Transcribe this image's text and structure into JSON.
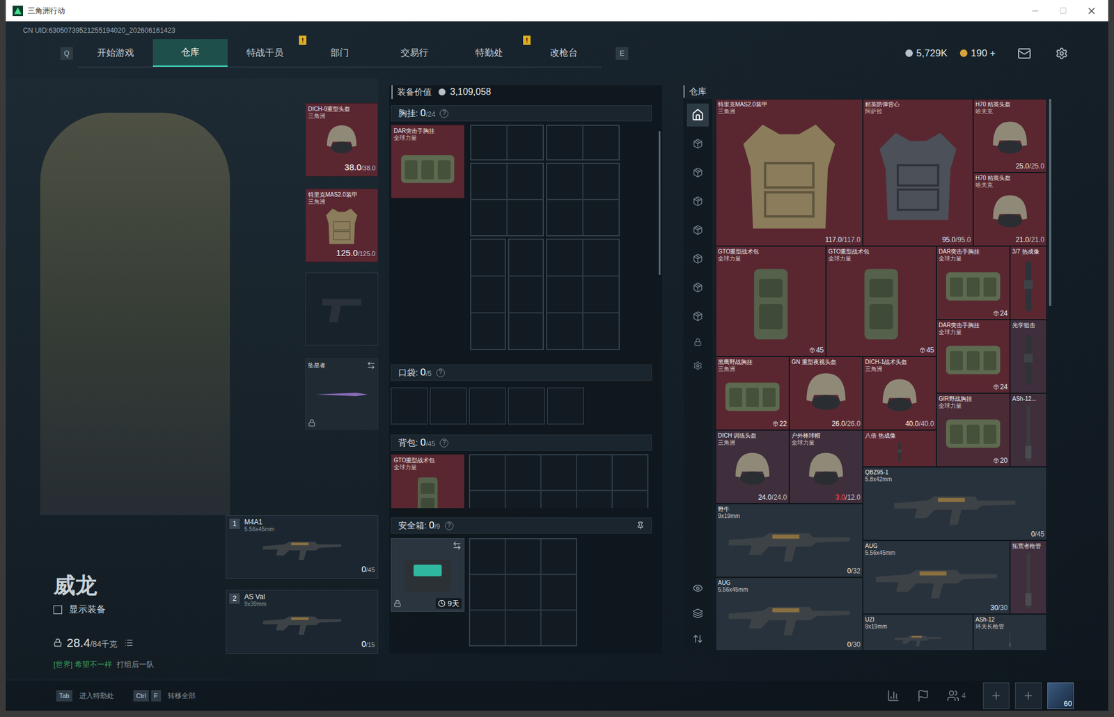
{
  "window": {
    "title": "三角洲行动"
  },
  "uid": "CN UID:63050739521255194020_202606161423",
  "nav": {
    "key_left": "Q",
    "key_right": "E",
    "tabs": [
      {
        "label": "开始游戏",
        "selected": false,
        "badge": ""
      },
      {
        "label": "仓库",
        "selected": true,
        "badge": ""
      },
      {
        "label": "特战干员",
        "selected": false,
        "badge": "!"
      },
      {
        "label": "部门",
        "selected": false,
        "badge": ""
      },
      {
        "label": "交易行",
        "selected": false,
        "badge": ""
      },
      {
        "label": "特勤处",
        "selected": false,
        "badge": "!"
      },
      {
        "label": "改枪台",
        "selected": false,
        "badge": ""
      }
    ],
    "currency": [
      {
        "value": "5,729K",
        "color": "#b8c0c8"
      },
      {
        "value": "190 +",
        "color": "#d8a43a"
      }
    ]
  },
  "character": {
    "name": "威龙",
    "show_equipment": {
      "label": "显示装备",
      "checked": false
    },
    "weight": "28.4",
    "weight_max": "/84千克",
    "chat": {
      "channel": "[世界]",
      "sender": "希望不一样",
      "message": "打组后一队"
    }
  },
  "slots": {
    "helmet": {
      "name": "DICH-9重型头盔",
      "sub": "三角洲",
      "count": "38.0",
      "max": "/38.0"
    },
    "armor": {
      "name": "特里克MAS2.0装甲",
      "sub": "三角洲",
      "count": "125.0",
      "max": "/125.0"
    },
    "pistol": {
      "empty": true
    },
    "melee": {
      "name": "坠星者",
      "locked": true
    }
  },
  "weapons": [
    {
      "index": "1",
      "name": "M4A1",
      "caliber": "5.56x45mm",
      "ammo": "0",
      "max": "/45"
    },
    {
      "index": "2",
      "name": "AS Val",
      "caliber": "9x39mm",
      "ammo": "0",
      "max": "/15"
    }
  ],
  "loadout": {
    "value_label": "装备价值",
    "value": "3,109,058",
    "chest": {
      "label": "胸挂:",
      "count": "0",
      "capacity": "/24",
      "help": "?",
      "item": {
        "name": "DAR突击手胸挂",
        "sub": "全球力量",
        "kind": "rig"
      }
    },
    "pocket": {
      "label": "口袋:",
      "count": "0",
      "capacity": "/5",
      "help": "?"
    },
    "backpack": {
      "label": "背包:",
      "count": "0",
      "capacity": "/45",
      "help": "?",
      "item": {
        "name": "GTO重型战术包",
        "sub": "全球力量",
        "kind": "bag"
      }
    },
    "secure": {
      "label": "安全箱:",
      "count": "0",
      "capacity": "/9",
      "help": "?",
      "item": {
        "kind": "case",
        "locked": true,
        "timer": "9天"
      }
    }
  },
  "warehouse": {
    "title": "仓库",
    "tabs": [
      {
        "selected": true
      },
      {
        "selected": false
      },
      {
        "selected": false
      },
      {
        "selected": false
      },
      {
        "selected": false
      },
      {
        "selected": false
      },
      {
        "selected": false
      },
      {
        "selected": false
      }
    ],
    "items": [
      {
        "name": "特里克MAS2.0装甲",
        "sub": "三角洲",
        "kind": "armor",
        "count": "117.0",
        "max": "/117.0",
        "low": false,
        "color": "#5a2731"
      },
      {
        "name": "精英防弹背心",
        "sub": "阿萨拉",
        "kind": "vest",
        "count": "95.0",
        "max": "/95.0",
        "low": false,
        "color": "#5a2731"
      },
      {
        "name": "H70 精英头盔",
        "sub": "哈夫克",
        "kind": "helmet",
        "count": "25.0",
        "max": "/25.0",
        "low": false,
        "color": "#5a2731"
      },
      {
        "name": "H70 精英头盔",
        "sub": "哈夫克",
        "kind": "helmet",
        "count": "21.0",
        "max": "/21.0",
        "low": false,
        "color": "#5a2731"
      },
      {
        "name": "GTO重型战术包",
        "sub": "全球力量",
        "kind": "bag",
        "count": "45",
        "max": "",
        "low": false,
        "color": "#5a2731"
      },
      {
        "name": "GTO重型战术包",
        "sub": "全球力量",
        "kind": "bag",
        "count": "45",
        "max": "",
        "low": false,
        "color": "#5a2731"
      },
      {
        "name": "DAR突击手胸挂",
        "sub": "全球力量",
        "kind": "rig",
        "count": "24",
        "max": "",
        "low": false,
        "color": "#5a2731"
      },
      {
        "name": "3/7 热成像",
        "sub": "",
        "kind": "scope",
        "count": "",
        "max": "",
        "low": false,
        "color": "#5a2731"
      },
      {
        "name": "DAR突击手胸挂",
        "sub": "全球力量",
        "kind": "rig",
        "count": "24",
        "max": "",
        "low": false,
        "color": "#5a2731"
      },
      {
        "name": "光学狙击",
        "sub": "",
        "kind": "scope",
        "count": "",
        "max": "",
        "low": false,
        "color": "#3f2e3c"
      },
      {
        "name": "黑鹰野战胸挂",
        "sub": "三角洲",
        "kind": "rig",
        "count": "22",
        "max": "",
        "low": false,
        "color": "#5a2731"
      },
      {
        "name": "GN 重型夜视头盔",
        "sub": "",
        "kind": "helmet",
        "count": "26.0",
        "max": "/26.0",
        "low": false,
        "color": "#5a2731"
      },
      {
        "name": "DICH-1战术头盔",
        "sub": "三角洲",
        "kind": "helmet",
        "count": "40.0",
        "max": "/40.0",
        "low": false,
        "color": "#5a2731"
      },
      {
        "name": "GIR野战胸挂",
        "sub": "全球力量",
        "kind": "rig",
        "count": "20",
        "max": "",
        "low": false,
        "color": "#4a2b36"
      },
      {
        "name": "ASh-12...",
        "sub": "",
        "kind": "part",
        "count": "",
        "max": "",
        "low": false,
        "color": "#3f2e3c"
      },
      {
        "name": "DICH 训练头盔",
        "sub": "三角洲",
        "kind": "helmet",
        "count": "24.0",
        "max": "/24.0",
        "low": false,
        "color": "#3f2e3c"
      },
      {
        "name": "户外棒球帽",
        "sub": "全球力量",
        "kind": "helmet",
        "count": "3.0",
        "max": "/12.0",
        "low": true,
        "color": "#3f2e3c"
      },
      {
        "name": "八倍 热成像",
        "sub": "",
        "kind": "scope",
        "count": "",
        "max": "",
        "low": false,
        "color": "#5a2731"
      },
      {
        "name": "QBZ95-1",
        "sub": "5.8x42mm",
        "kind": "rifle",
        "count": "0",
        "max": "/45",
        "low": false,
        "color": "#28323c"
      },
      {
        "name": "野牛",
        "sub": "9x19mm",
        "kind": "rifle",
        "count": "0",
        "max": "/32",
        "low": false,
        "color": "#28323c"
      },
      {
        "name": "AUG",
        "sub": "5.56x45mm",
        "kind": "rifle",
        "count": "30",
        "max": "/30",
        "low": false,
        "color": "#28323c"
      },
      {
        "name": "拓荒者枪管",
        "sub": "",
        "kind": "part",
        "count": "",
        "max": "",
        "low": false,
        "color": "#3f2e3c"
      },
      {
        "name": "AUG",
        "sub": "5.56x45mm",
        "kind": "rifle",
        "count": "0",
        "max": "/30",
        "low": false,
        "color": "#28323c"
      },
      {
        "name": "UZI",
        "sub": "9x19mm",
        "kind": "rifle",
        "count": "",
        "max": "",
        "low": false,
        "color": "#28323c"
      },
      {
        "name": "ASh-12",
        "sub": "环天长枪管",
        "kind": "part",
        "count": "",
        "max": "",
        "low": false,
        "color": "#28323c"
      }
    ]
  },
  "bottom": {
    "hints": [
      {
        "keys": [
          "Tab"
        ],
        "label": "进入特勤处"
      },
      {
        "keys": [
          "Ctrl",
          "F"
        ],
        "label": "转移全部"
      }
    ],
    "squad": "4",
    "level": "60"
  }
}
